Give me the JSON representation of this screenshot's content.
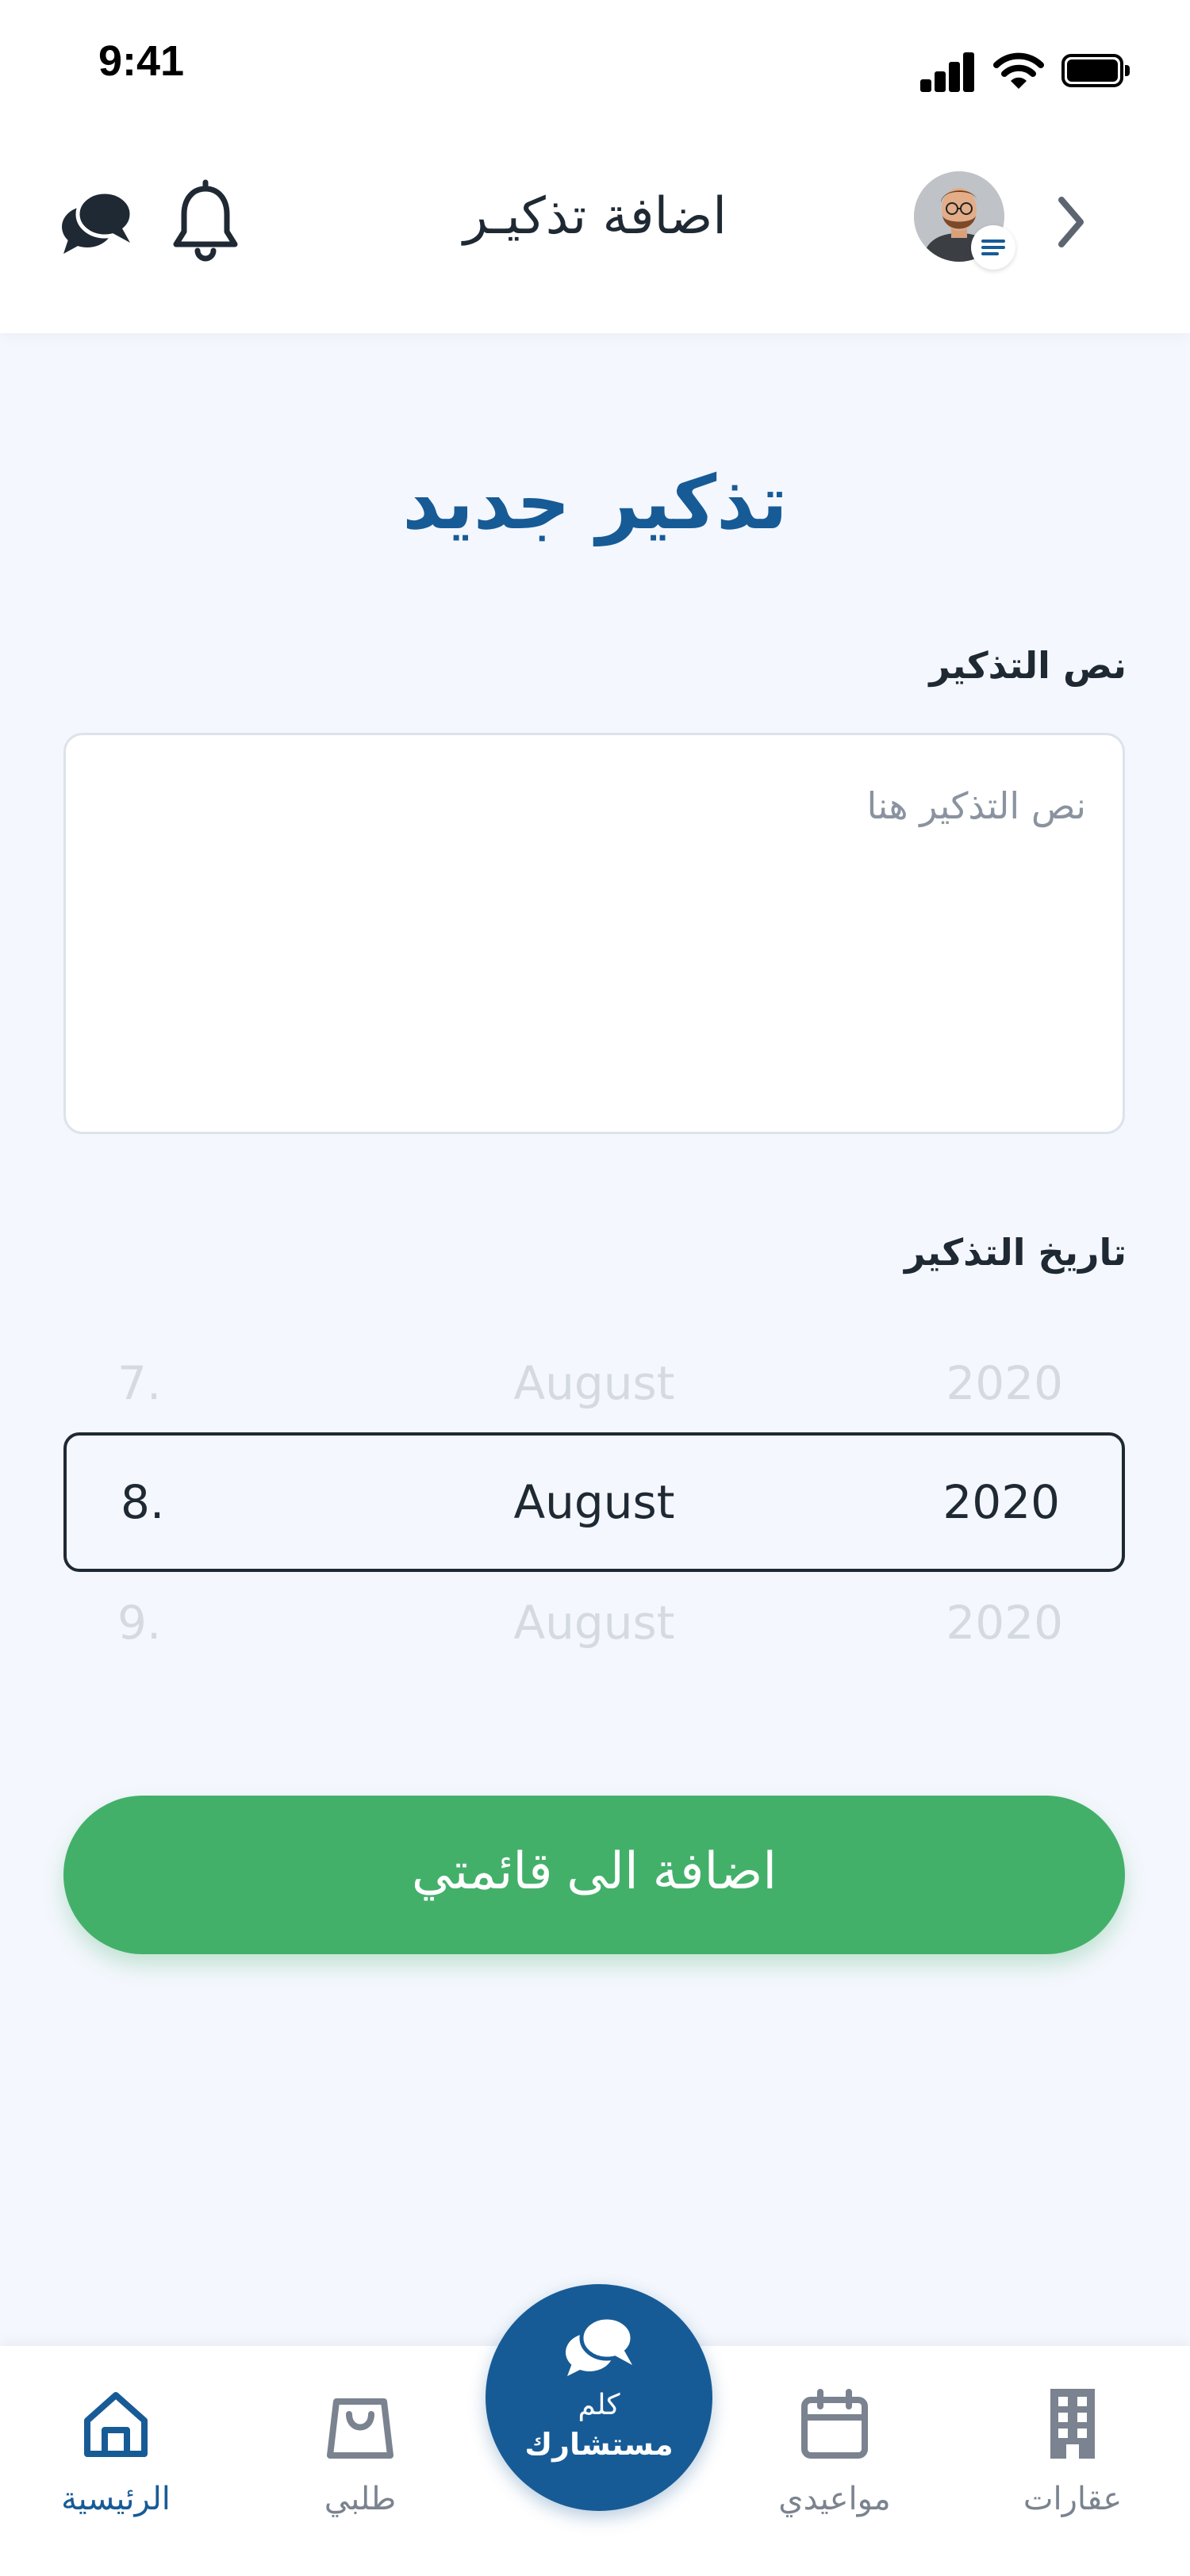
{
  "status_bar": {
    "time": "9:41"
  },
  "header": {
    "title": "اضافة تذكيـر"
  },
  "form": {
    "title": "تذكير جديد",
    "text_label": "نص التذكير",
    "text_placeholder": "نص التذكير هنا",
    "date_label": "تاريخ التذكير",
    "date_picker": {
      "prev": {
        "day": "7.",
        "month": "August",
        "year": "2020"
      },
      "selected": {
        "day": "8.",
        "month": "August",
        "year": "2020"
      },
      "next": {
        "day": "9.",
        "month": "August",
        "year": "2020"
      }
    },
    "submit_label": "اضافة الى قائمتي"
  },
  "bottom_nav": {
    "items": [
      {
        "label": "الرئيسية",
        "icon": "home-icon",
        "active": true
      },
      {
        "label": "طلبي",
        "icon": "shopping-bag-icon",
        "active": false
      },
      {
        "label": "مواعيدي",
        "icon": "calendar-icon",
        "active": false
      },
      {
        "label": "عقارات",
        "icon": "building-icon",
        "active": false
      }
    ],
    "fab": {
      "line1": "كلم",
      "line2": "مستشارك",
      "icon": "chat-bubbles-icon"
    }
  },
  "colors": {
    "primary": "#175B96",
    "accent_green": "#43B06A",
    "background": "#F4F7FD",
    "text_dark": "#1f2933",
    "muted": "#7A838F"
  }
}
